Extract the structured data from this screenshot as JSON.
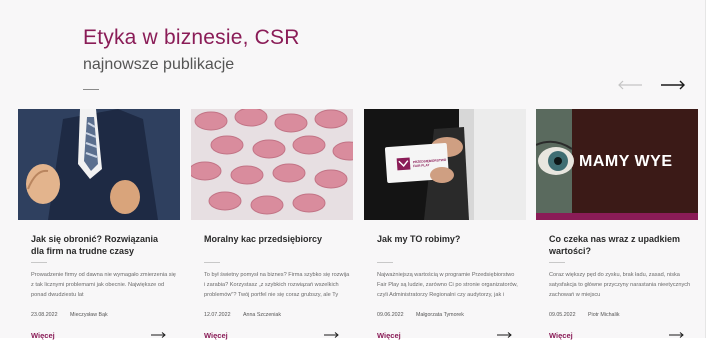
{
  "section": {
    "title": "Etyka w biznesie, CSR",
    "subtitle": "najnowsze publikacje"
  },
  "carousel": {
    "prev_icon": "arrow-left-icon",
    "next_icon": "arrow-right-icon",
    "active_arrow_color": "#1a1a1a",
    "inactive_arrow_color": "#c4c4c4"
  },
  "colors": {
    "accent": "#8a1c57",
    "banner_background": "#3b1a17"
  },
  "cards": [
    {
      "title": "Jak się obronić? Rozwiązania dla firm na trudne czasy",
      "excerpt": "Prowadzenie firmy od dawna nie wymagało zmierzenia się z tak licznymi problemami jak obecnie. Największe od ponad dwudziestu lat",
      "date": "23.08.2022",
      "author": "Mieczysław Bąk",
      "more": "Więcej",
      "image": "businessman-fists-photo"
    },
    {
      "title": "Moralny kac przedsiębiorcy",
      "excerpt": "To był świetny pomysł na biznes? Firma szybko się rozwija i zarabia? Korzystasz „z szybkich rozwiązań wszelkich problemów\"? Twój portfel nie się coraz grubszy, ale Ty",
      "date": "12.07.2022",
      "author": "Anna Szczeniak",
      "more": "Więcej",
      "image": "pink-pills-blister-photo"
    },
    {
      "title": "Jak my TO robimy?",
      "excerpt": "Najważniejszą wartością w programie Przedsiębiorstwo Fair Play są ludzie, zarówno Ci po stronie organizatorów, czyli Administratorzy Regionalni czy audytorzy, jak i",
      "date": "09.06.2022",
      "author": "Małgorzata Tymorek",
      "more": "Więcej",
      "image": "fair-play-card-photo",
      "card_text": "PRZEDSIĘBIORSTWO FAIR PLAY"
    },
    {
      "title": "Co czeka nas wraz z upadkiem wartości?",
      "excerpt": "Coraz większy pęd do zysku, brak ładu, zasad, niska satysfakcja to główne przyczyny narastania nieetycznych zachowań w miejscu",
      "date": "09.05.2022",
      "author": "Piotr Michalik",
      "more": "Więcej",
      "image": "eye-banner-photo",
      "banner_text": "MAMY WYE"
    }
  ]
}
